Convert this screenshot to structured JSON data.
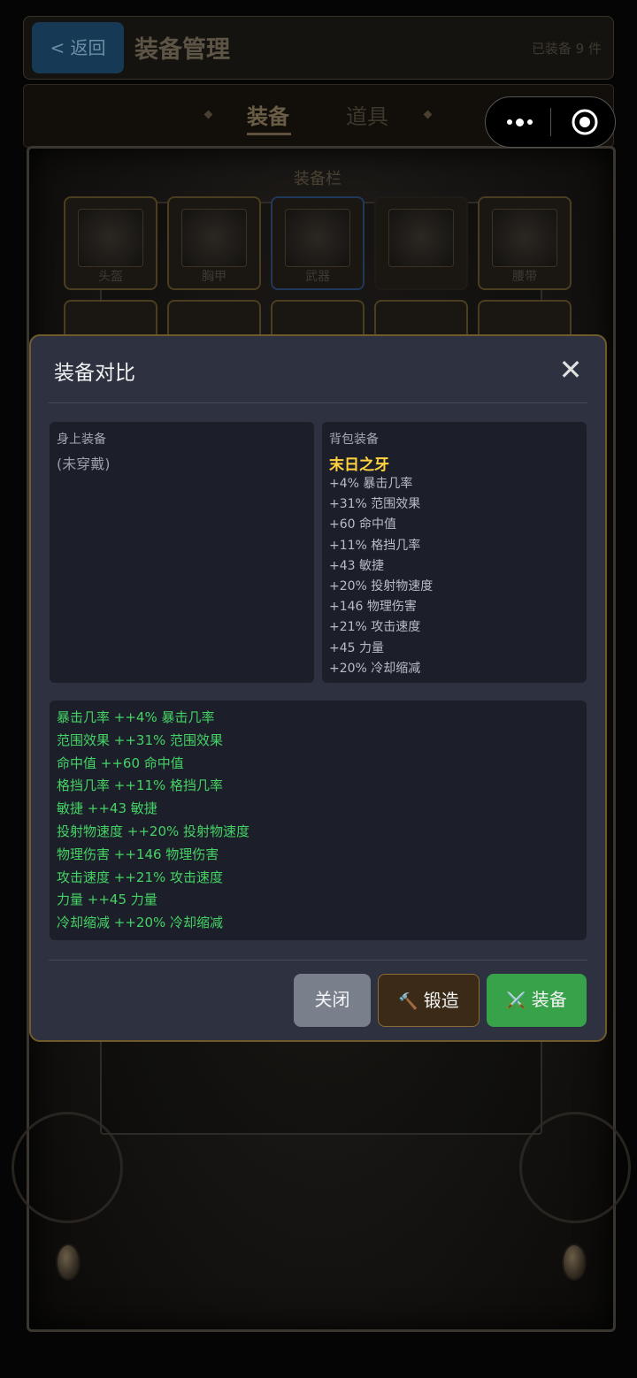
{
  "header": {
    "back_label": "< 返回",
    "title": "装备管理",
    "equipped_count": "已装备 9 件"
  },
  "tabs": [
    {
      "label": "装备",
      "active": true
    },
    {
      "label": "道具",
      "active": false
    }
  ],
  "slots_section": {
    "title": "装备栏",
    "slots": [
      {
        "label": "头盔",
        "state": "filled"
      },
      {
        "label": "胸甲",
        "state": "filled"
      },
      {
        "label": "武器",
        "state": "selected"
      },
      {
        "label": "",
        "state": "empty"
      },
      {
        "label": "腰带",
        "state": "filled"
      }
    ]
  },
  "capsule": {
    "more_icon": "more-dots-icon",
    "close_icon": "target-circle-icon"
  },
  "modal": {
    "title": "装备对比",
    "close_glyph": "✕",
    "current": {
      "heading": "身上装备",
      "empty_text": "(未穿戴)"
    },
    "bag": {
      "heading": "背包装备",
      "name": "末日之牙",
      "stats": [
        "+4% 暴击几率",
        "+31% 范围效果",
        "+60 命中值",
        "+11% 格挡几率",
        "+43 敏捷",
        "+20% 投射物速度",
        "+146 物理伤害",
        "+21% 攻击速度",
        "+45 力量",
        "+20% 冷却缩减"
      ]
    },
    "diff": [
      "暴击几率 ++4% 暴击几率",
      "范围效果 ++31% 范围效果",
      "命中值 ++60 命中值",
      "格挡几率 ++11% 格挡几率",
      "敏捷 ++43 敏捷",
      "投射物速度 ++20% 投射物速度",
      "物理伤害 ++146 物理伤害",
      "攻击速度 ++21% 攻击速度",
      "力量 ++45 力量",
      "冷却缩减 ++20% 冷却缩减"
    ],
    "buttons": {
      "close": "关闭",
      "forge_icon": "🔨",
      "forge": "锻造",
      "equip_icon": "⚔️",
      "equip": "装备"
    }
  },
  "colors": {
    "item_name": "#ffd23f",
    "diff_text": "#45d264",
    "equip_button": "#37a24a",
    "modal_border": "#6f5a2c"
  }
}
